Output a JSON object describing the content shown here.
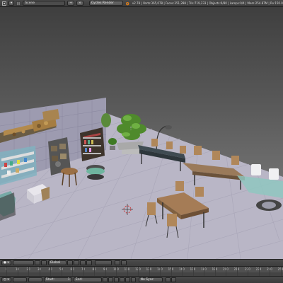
{
  "header": {
    "scene_label": "Scene",
    "render_engine": "Cycles Render",
    "stats": "v2.78 | Verts:365,078 | Faces:351,288 | Tris:719,233 | Objects:0/80 | Lamps:0/4 | Mem:254.87M | Rv:150.0 | Cu"
  },
  "viewbar": {
    "mode": "",
    "pivot": "Global"
  },
  "timeline": {
    "ticks": [
      "0",
      "10",
      "20",
      "30",
      "40",
      "50",
      "60",
      "70",
      "80",
      "90",
      "100",
      "110",
      "120",
      "130",
      "140",
      "150",
      "160",
      "170",
      "180",
      "190",
      "200",
      "210",
      "220",
      "230",
      "240",
      "250"
    ]
  },
  "playbar": {
    "start_label": "Start:",
    "start_value": "1",
    "end_label": "End:",
    "end_value": "",
    "sync": "No Sync"
  },
  "colors": {
    "floor": "#b9b6c6",
    "wall": "#9d9bb0",
    "accent": "#5e9a4c"
  }
}
